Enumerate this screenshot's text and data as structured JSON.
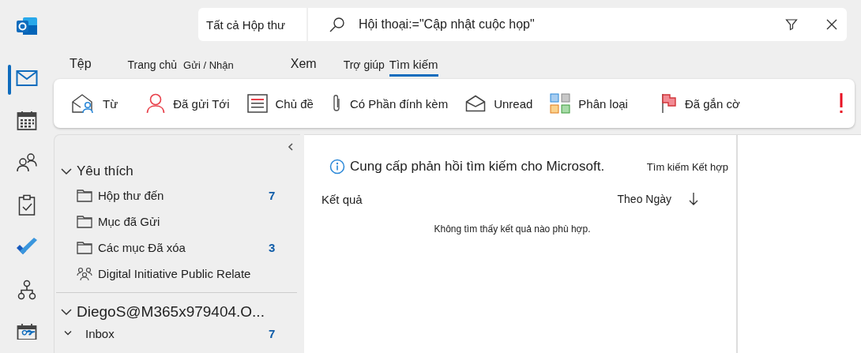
{
  "rail": [
    {
      "kind": "logo",
      "selected": false
    },
    {
      "kind": "mail",
      "selected": true
    },
    {
      "kind": "calendar",
      "selected": false
    },
    {
      "kind": "people",
      "selected": false
    },
    {
      "kind": "tasks",
      "selected": false
    },
    {
      "kind": "todo",
      "selected": false
    },
    {
      "kind": "org",
      "selected": false
    },
    {
      "kind": "bookings",
      "selected": false
    }
  ],
  "search": {
    "scope": "Tất cả Hộp thư",
    "value": "Hội thoại:=\"Cập nhật cuộc họp\""
  },
  "tabs": [
    {
      "label": "Tệp",
      "selected": false
    },
    {
      "label": "Trang chủ",
      "selected": false
    },
    {
      "label": "Gửi / Nhận",
      "selected": false
    },
    {
      "label": "Xem",
      "selected": false
    },
    {
      "label": "Trợ giúp",
      "selected": false
    },
    {
      "label": "Tìm kiếm",
      "selected": true
    }
  ],
  "ribbon": [
    {
      "kind": "from",
      "label": "Từ"
    },
    {
      "kind": "sent-to",
      "label": "Đã gửi Tới"
    },
    {
      "kind": "subject",
      "label": "Chủ đề"
    },
    {
      "kind": "attachment",
      "label": "Có Phần đính kèm"
    },
    {
      "kind": "unread",
      "label": "Unread"
    },
    {
      "kind": "categorized",
      "label": "Phân loại"
    },
    {
      "kind": "flagged",
      "label": "Đã gắn cờ"
    },
    {
      "kind": "important"
    }
  ],
  "folders": {
    "favorites": {
      "title": "Yêu thích",
      "expanded": true,
      "items": [
        {
          "kind": "folder",
          "name": "Hộp thư đến",
          "count": "7"
        },
        {
          "kind": "folder",
          "name": "Mục đã Gửi"
        },
        {
          "kind": "folder",
          "name": "Các mục Đã xóa",
          "count": "3"
        },
        {
          "kind": "group",
          "name": "Digital Initiative Public Relate"
        }
      ]
    },
    "account": {
      "title": "DiegoS@M365x979404.O...",
      "expanded": true,
      "items": [
        {
          "kind": "folder-expanded",
          "name": "Inbox",
          "count": "7"
        }
      ]
    }
  },
  "results": {
    "feedback": "Cung cấp phản hồi tìm kiếm cho Microsoft.",
    "combined": "Tìm kiếm Kết hợp",
    "heading": "Kết quả",
    "sort": "Theo Ngày",
    "empty": "Không tìm thấy kết quả nào phù hợp."
  }
}
